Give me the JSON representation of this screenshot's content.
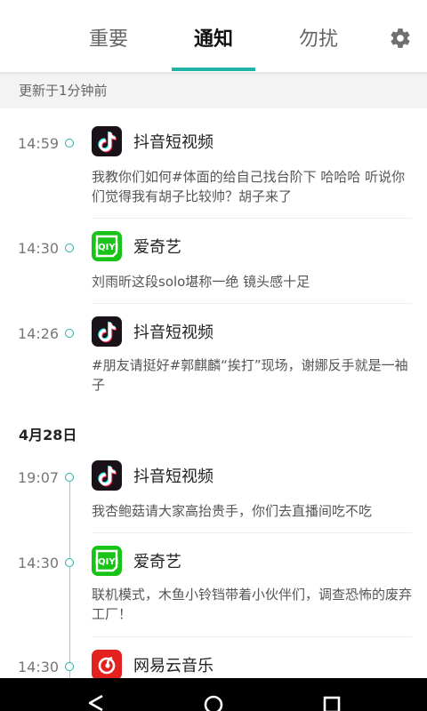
{
  "tabs": [
    {
      "label": "重要"
    },
    {
      "label": "通知",
      "active": true
    },
    {
      "label": "勿扰"
    }
  ],
  "updated_text": "更新于1分钟前",
  "today": [
    {
      "time": "14:59",
      "app": "抖音短视频",
      "icon": "tiktok-icon",
      "message": "我教你们如何#体面的给自己找台阶下 哈哈哈 听说你们觉得我有胡子比较帅？胡子来了"
    },
    {
      "time": "14:30",
      "app": "爱奇艺",
      "icon": "iqiyi-icon",
      "message": "刘雨昕这段solo堪称一绝 镜头感十足"
    },
    {
      "time": "14:26",
      "app": "抖音短视频",
      "icon": "tiktok-icon",
      "message": "#朋友请挺好#郭麒麟“挨打”现场，谢娜反手就是一袖子"
    }
  ],
  "section_date": "4月28日",
  "earlier": [
    {
      "time": "19:07",
      "app": "抖音短视频",
      "icon": "tiktok-icon",
      "message": "我杏鲍菇请大家高抬贵手，你们去直播间吃不吃"
    },
    {
      "time": "14:30",
      "app": "爱奇艺",
      "icon": "iqiyi-icon",
      "message": "联机模式，木鱼小铃铛带着小伙伴们，调查恐怖的废弃工厂！"
    },
    {
      "time": "14:30",
      "app": "网易云音乐",
      "icon": "netease-music-icon",
      "message": ""
    }
  ],
  "colors": {
    "accent": "#1fb4a6",
    "tiktok": "#1a1219",
    "iqiyi": "#18c417",
    "netease": "#e3211f"
  }
}
